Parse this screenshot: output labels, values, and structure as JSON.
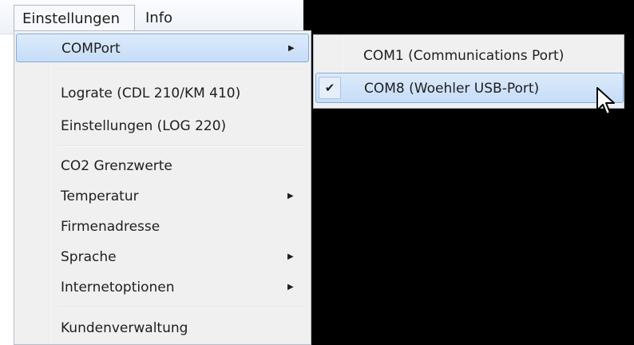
{
  "menubar": {
    "items": [
      {
        "label": "Einstellungen"
      },
      {
        "label": "Info"
      }
    ]
  },
  "dropdown": {
    "items": [
      {
        "label": "COMPort",
        "submenu": true
      },
      {
        "label": "Lograte (CDL 210/KM 410)"
      },
      {
        "label": "Einstellungen (LOG 220)"
      },
      {
        "label": "CO2 Grenzwerte"
      },
      {
        "label": "Temperatur",
        "submenu": true
      },
      {
        "label": "Firmenadresse"
      },
      {
        "label": "Sprache",
        "submenu": true
      },
      {
        "label": "Internetoptionen",
        "submenu": true
      },
      {
        "label": "Kundenverwaltung"
      }
    ],
    "submenu_arrow": "▶"
  },
  "submenu": {
    "items": [
      {
        "label": "COM1  (Communications Port)",
        "checked": false
      },
      {
        "label": "COM8  (Woehler USB-Port)",
        "checked": true
      }
    ],
    "check_glyph": "✔"
  },
  "icons": {
    "check": "check-icon",
    "arrow": "chevron-right-icon",
    "cursor": "mouse-pointer-icon"
  }
}
